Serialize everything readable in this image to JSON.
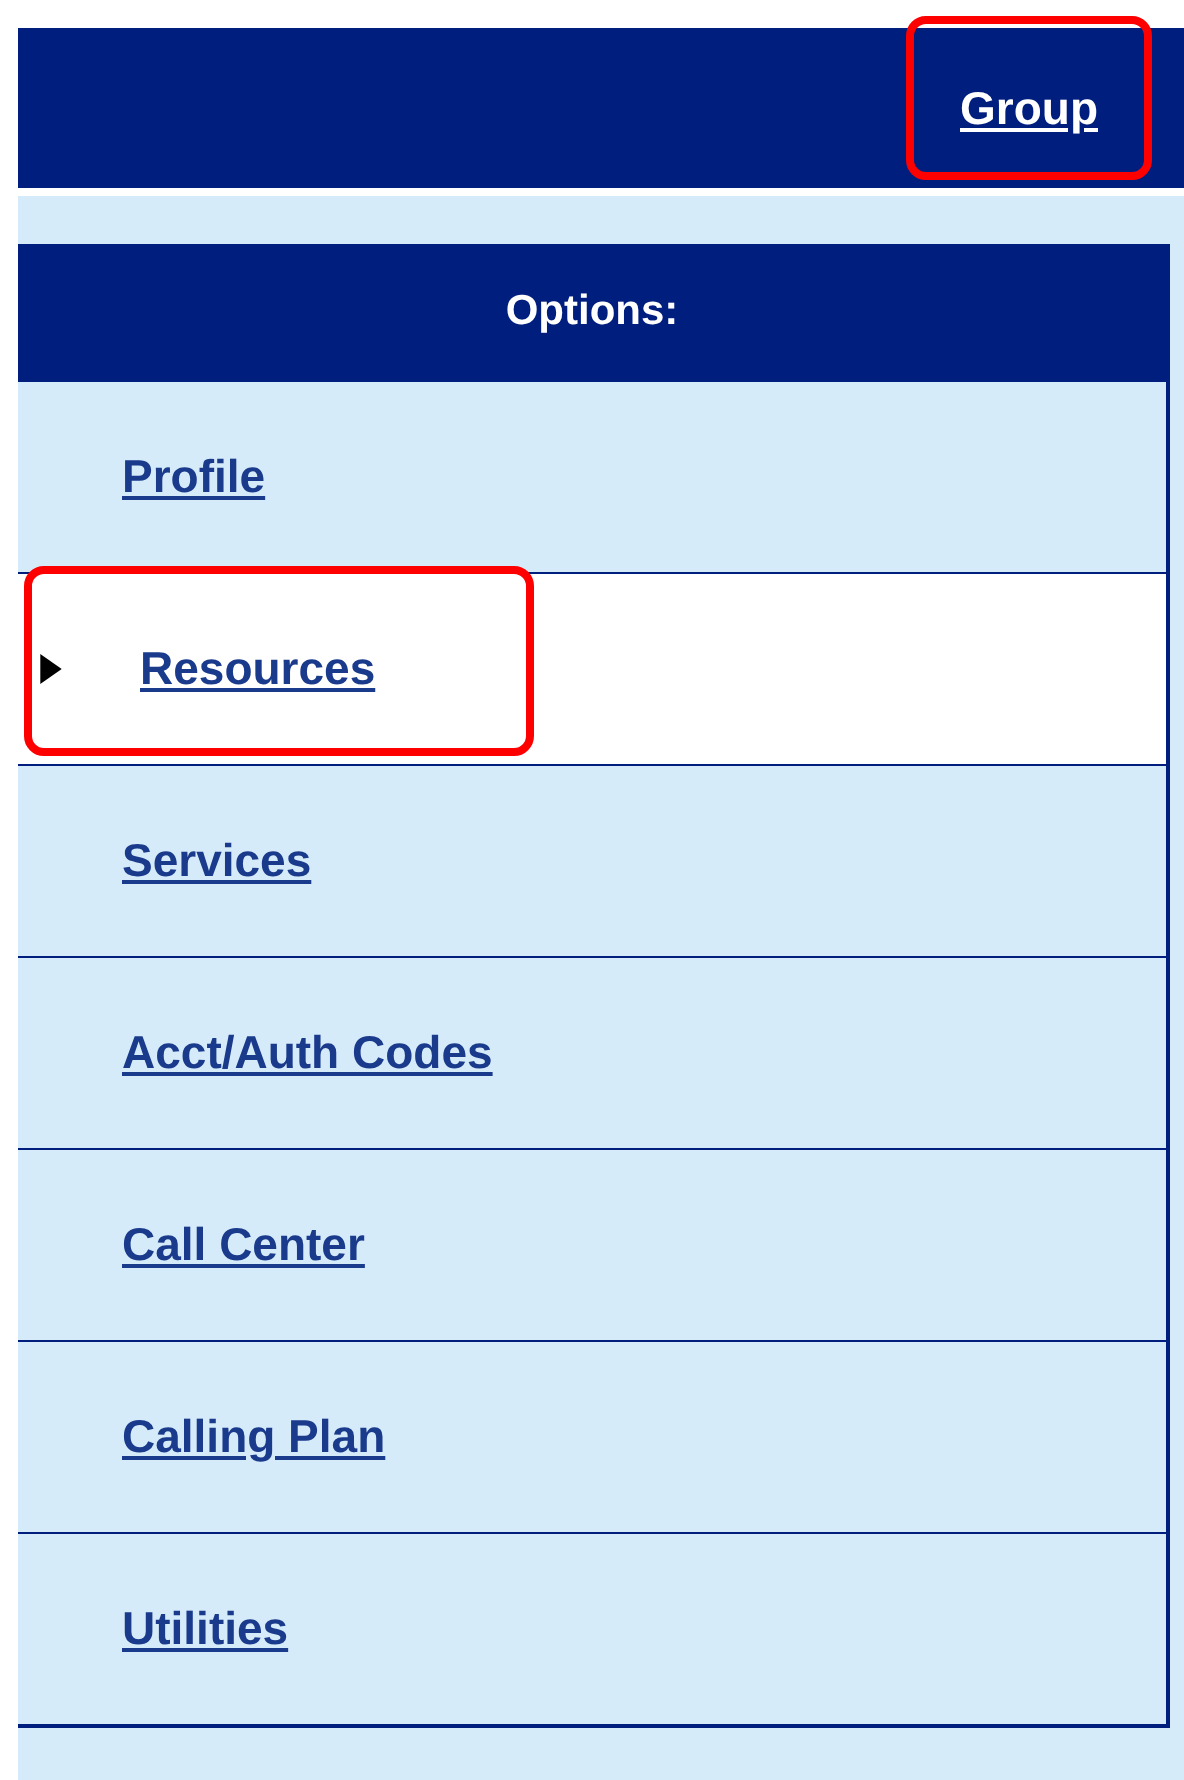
{
  "header": {
    "link": {
      "label": "Group",
      "highlighted": true
    }
  },
  "options": {
    "title": "Options:",
    "items": [
      {
        "label": "Profile",
        "selected": false,
        "highlighted": false
      },
      {
        "label": "Resources",
        "selected": true,
        "highlighted": true
      },
      {
        "label": "Services",
        "selected": false,
        "highlighted": false
      },
      {
        "label": "Acct/Auth Codes",
        "selected": false,
        "highlighted": false
      },
      {
        "label": "Call Center",
        "selected": false,
        "highlighted": false
      },
      {
        "label": "Calling Plan",
        "selected": false,
        "highlighted": false
      },
      {
        "label": "Utilities",
        "selected": false,
        "highlighted": false
      }
    ]
  }
}
